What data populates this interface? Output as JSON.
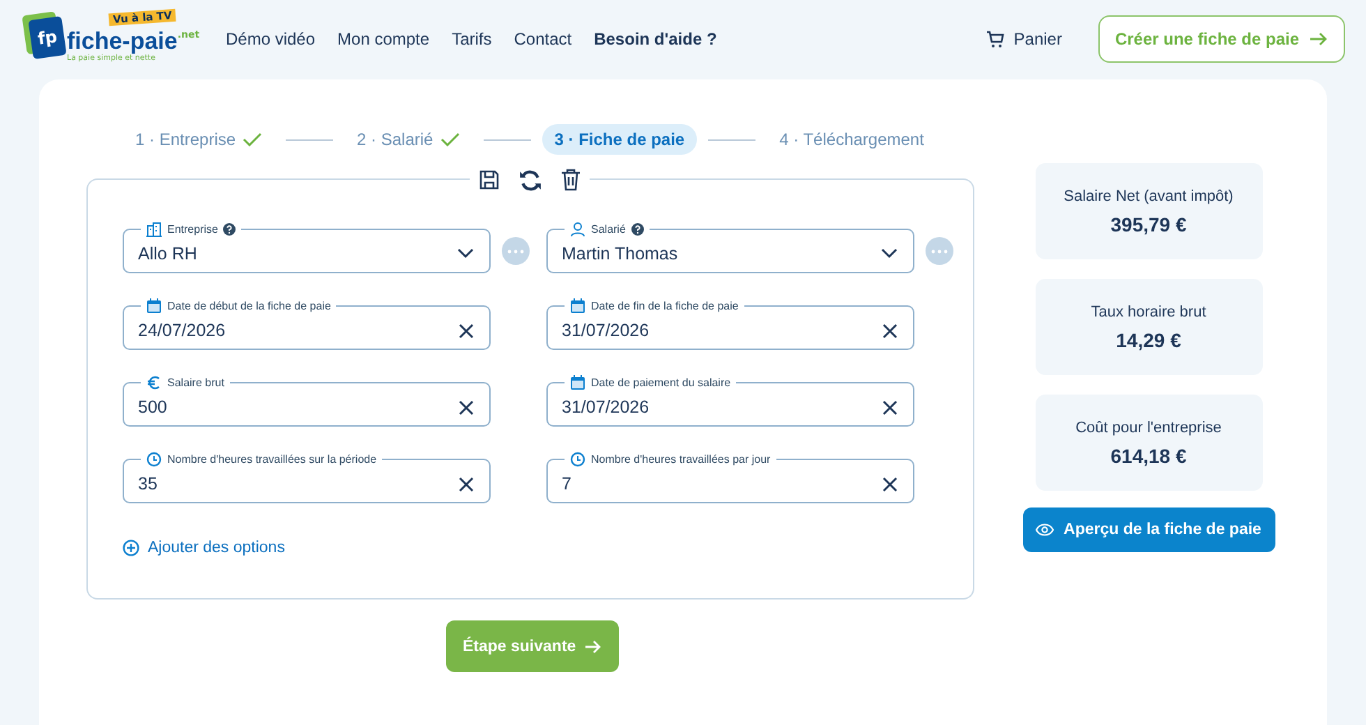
{
  "logo": {
    "badge": "Vu à la TV",
    "mark": "fp",
    "name": "fiche-paie",
    "suffix": ".net",
    "tagline": "La paie simple et nette"
  },
  "nav": [
    {
      "label": "Démo vidéo",
      "bold": false
    },
    {
      "label": "Mon compte",
      "bold": false
    },
    {
      "label": "Tarifs",
      "bold": false
    },
    {
      "label": "Contact",
      "bold": false
    },
    {
      "label": "Besoin d'aide ?",
      "bold": true
    }
  ],
  "cart": {
    "label": "Panier"
  },
  "cta": {
    "label": "Créer une fiche de paie"
  },
  "steps": [
    {
      "number": "1 ·",
      "label": "Entreprise",
      "done": true,
      "selected": false
    },
    {
      "number": "2 ·",
      "label": "Salarié",
      "done": true,
      "selected": false
    },
    {
      "number": "3 ·",
      "label": "Fiche de paie",
      "done": false,
      "selected": true
    },
    {
      "number": "4 ·",
      "label": "Téléchargement",
      "done": false,
      "selected": false
    }
  ],
  "fields": [
    {
      "kind": "select",
      "label": "Entreprise",
      "value": "Allo RH",
      "help": true
    },
    {
      "kind": "select",
      "label": "Salarié",
      "value": "Martin Thomas",
      "help": true
    },
    {
      "kind": "input",
      "label": "Date de début de la fiche de paie",
      "value": "24/07/2026",
      "help": false
    },
    {
      "kind": "input",
      "label": "Date de fin de la fiche de paie",
      "value": "31/07/2026",
      "help": false
    },
    {
      "kind": "input",
      "label": "Salaire brut",
      "value": "500",
      "help": false
    },
    {
      "kind": "input",
      "label": "Date de paiement du salaire",
      "value": "31/07/2026",
      "help": false
    },
    {
      "kind": "input",
      "label": "Nombre d'heures travaillées sur la période",
      "value": "35",
      "help": false
    },
    {
      "kind": "input",
      "label": "Nombre d'heures travaillées par jour",
      "value": "7",
      "help": false
    }
  ],
  "add_options": {
    "label": "Ajouter des options"
  },
  "next": {
    "label": "Étape suivante"
  },
  "summary": [
    {
      "label": "Salaire Net (avant impôt)",
      "value": "395,79 €"
    },
    {
      "label": "Taux horaire brut",
      "value": "14,29 €"
    },
    {
      "label": "Coût pour l'entreprise",
      "value": "614,18 €"
    }
  ],
  "preview": {
    "label": "Aperçu de la fiche de paie"
  }
}
